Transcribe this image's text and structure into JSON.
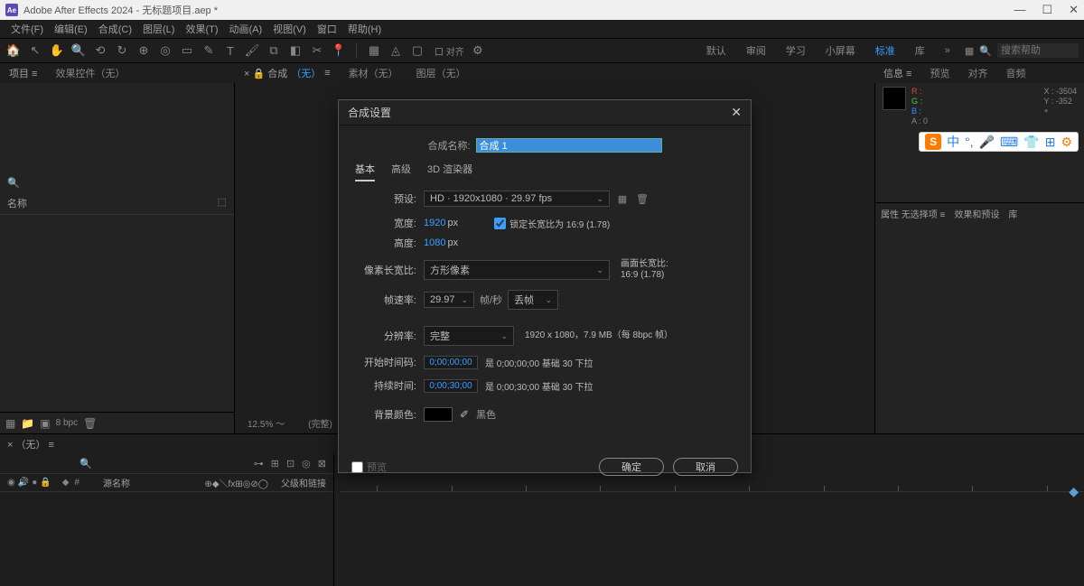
{
  "titlebar": {
    "app": "Ae",
    "title": "Adobe After Effects 2024 - 无标题项目.aep *"
  },
  "menus": [
    "文件(F)",
    "编辑(E)",
    "合成(C)",
    "图层(L)",
    "效果(T)",
    "动画(A)",
    "视图(V)",
    "窗口",
    "帮助(H)"
  ],
  "workspaces": {
    "items": [
      "默认",
      "审阅",
      "学习",
      "小屏幕",
      "标准",
      "库"
    ],
    "active": "标准",
    "more": "»"
  },
  "search_placeholder": "搜索帮助",
  "toolbar_align": "口 对齐",
  "left_panel": {
    "tabs": [
      "项目 ≡",
      "效果控件（无）"
    ],
    "name_col": "名称",
    "bpc": "8 bpc"
  },
  "center_panel": {
    "tabs": {
      "comp_prefix": "× 🔒 合成",
      "comp_name": "（无）",
      "footage": "素材（无）",
      "layer": "图层（无）"
    },
    "zoom": "12.5%  ～",
    "res": "(完整)"
  },
  "right_panel": {
    "tabs": [
      "信息 ≡",
      "预览",
      "对齐",
      "音频"
    ],
    "rgba": [
      "R :",
      "G :",
      "B :",
      "A : 0"
    ],
    "coords": {
      "x": "X : -3504",
      "y": "Y : -352",
      "plus": "+"
    },
    "prop_tabs": [
      "属性 无选择项 ≡",
      "效果和预设",
      "库"
    ]
  },
  "timeline": {
    "tab": "×  （无） ≡",
    "header": {
      "col_name": "源名称",
      "switches": "⊕◆＼fx⊞◎⊘◯",
      "parent": "父级和链接"
    }
  },
  "dialog": {
    "title": "合成设置",
    "name_label": "合成名称:",
    "name_value": "合成 1",
    "tabs": [
      "基本",
      "高级",
      "3D 渲染器"
    ],
    "preset": {
      "label": "预设:",
      "value": "HD · 1920x1080 · 29.97 fps"
    },
    "width": {
      "label": "宽度:",
      "value": "1920",
      "unit": "px"
    },
    "height": {
      "label": "高度:",
      "value": "1080",
      "unit": "px"
    },
    "lock_aspect": {
      "label": "锁定长宽比为 16:9 (1.78)"
    },
    "par": {
      "label": "像素长宽比:",
      "value": "方形像素",
      "aside1": "画面长宽比:",
      "aside2": "16:9 (1.78)"
    },
    "fps": {
      "label": "帧速率:",
      "value": "29.97",
      "unit": "帧/秒",
      "drop": "丢帧"
    },
    "resolution": {
      "label": "分辨率:",
      "value": "完整",
      "info": "1920 x 1080，7.9 MB（每 8bpc 帧）"
    },
    "start": {
      "label": "开始时间码:",
      "value": "0;00;00;00",
      "info": "是 0;00;00;00 基础 30  下拉"
    },
    "duration": {
      "label": "持续时间:",
      "value": "0;00;30;00",
      "info": "是 0;00;30;00 基础 30  下拉"
    },
    "bgcolor": {
      "label": "背景颜色:",
      "name": "黑色"
    },
    "preview_check": "预览",
    "ok": "确定",
    "cancel": "取消"
  },
  "ime": {
    "logo": "S",
    "cn": "中"
  }
}
